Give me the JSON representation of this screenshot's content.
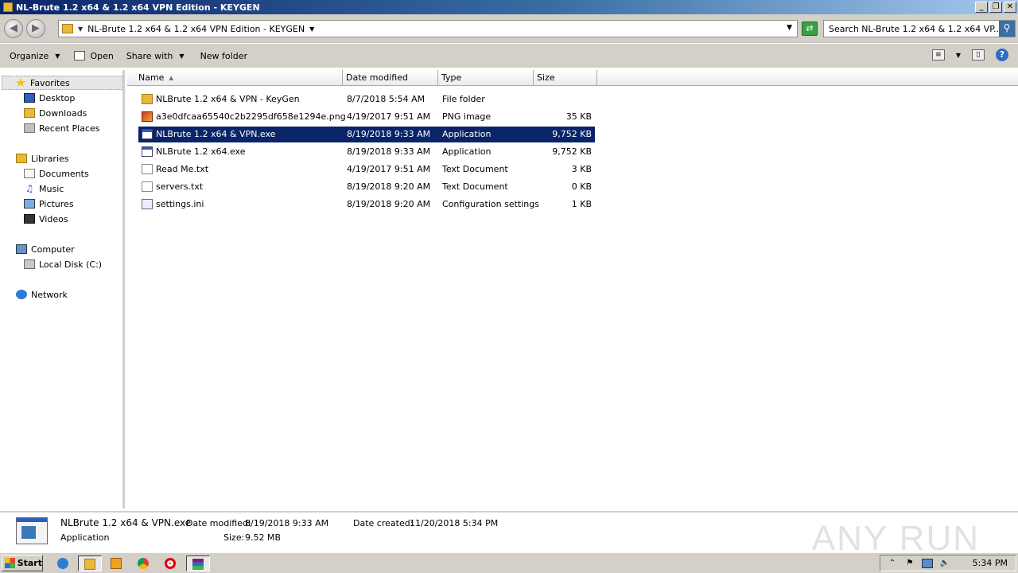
{
  "window": {
    "title": "NL-Brute 1.2 x64 & 1.2 x64 VPN Edition - KEYGEN",
    "buttons": {
      "minimize": "_",
      "maximize": "❐",
      "close": "✕"
    }
  },
  "address": {
    "path": "NL-Brute 1.2 x64 & 1.2 x64 VPN Edition - KEYGEN",
    "search_placeholder": "Search NL-Brute 1.2 x64 & 1.2 x64 VP..."
  },
  "toolbar": {
    "organize": "Organize",
    "open": "Open",
    "share_with": "Share with",
    "new_folder": "New folder"
  },
  "nav": {
    "favorites": "Favorites",
    "desktop": "Desktop",
    "downloads": "Downloads",
    "recent_places": "Recent Places",
    "libraries": "Libraries",
    "documents": "Documents",
    "music": "Music",
    "pictures": "Pictures",
    "videos": "Videos",
    "computer": "Computer",
    "local_disk": "Local Disk (C:)",
    "network": "Network"
  },
  "columns": {
    "name": "Name",
    "date": "Date modified",
    "type": "Type",
    "size": "Size"
  },
  "files": [
    {
      "name": "NLBrute 1.2 x64 & VPN - KeyGen",
      "date": "8/7/2018 5:54 AM",
      "type": "File folder",
      "size": "",
      "icon": "folder-icon"
    },
    {
      "name": "a3e0dfcaa65540c2b2295df658e1294e.png",
      "date": "4/19/2017 9:51 AM",
      "type": "PNG image",
      "size": "35 KB",
      "icon": "image-file-icon"
    },
    {
      "name": "NLBrute 1.2 x64 & VPN.exe",
      "date": "8/19/2018 9:33 AM",
      "type": "Application",
      "size": "9,752 KB",
      "icon": "application-icon"
    },
    {
      "name": "NLBrute 1.2 x64.exe",
      "date": "8/19/2018 9:33 AM",
      "type": "Application",
      "size": "9,752 KB",
      "icon": "application-icon"
    },
    {
      "name": "Read Me.txt",
      "date": "4/19/2017 9:51 AM",
      "type": "Text Document",
      "size": "3 KB",
      "icon": "text-file-icon"
    },
    {
      "name": "servers.txt",
      "date": "8/19/2018 9:20 AM",
      "type": "Text Document",
      "size": "0 KB",
      "icon": "text-file-icon"
    },
    {
      "name": "settings.ini",
      "date": "8/19/2018 9:20 AM",
      "type": "Configuration settings",
      "size": "1 KB",
      "icon": "settings-file-icon"
    }
  ],
  "details": {
    "filename": "NLBrute 1.2 x64 & VPN.exe",
    "filetype": "Application",
    "modified_label": "Date modified:",
    "modified_value": "8/19/2018 9:33 AM",
    "created_label": "Date created:",
    "created_value": "11/20/2018 5:34 PM",
    "size_label": "Size:",
    "size_value": "9.52 MB",
    "watermark": "ANY RUN"
  },
  "taskbar": {
    "start": "Start",
    "clock": "5:34 PM"
  },
  "colors": {
    "selection": "#0a246a",
    "titlebar": "#0a246a",
    "chrome": "#d4d0c8"
  }
}
